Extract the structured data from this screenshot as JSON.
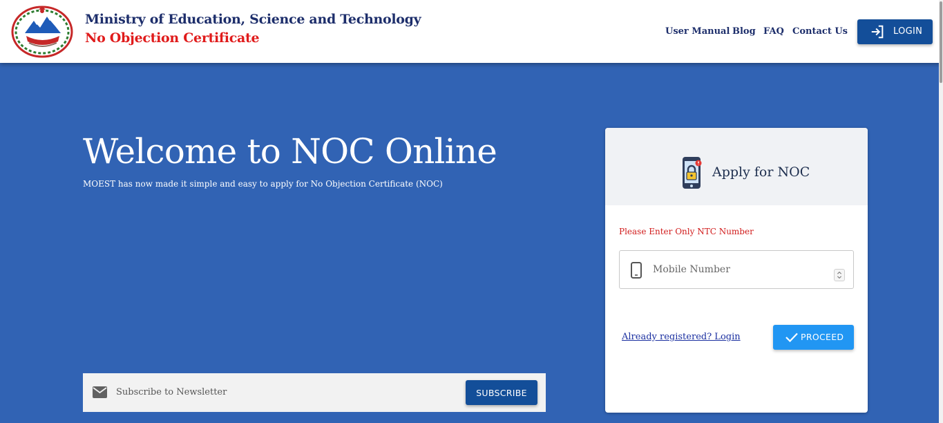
{
  "header": {
    "title": "Ministry of Education, Science and Technology",
    "subtitle": "No Objection Certificate",
    "nav": [
      {
        "label": "User Manual"
      },
      {
        "label": "Blog"
      },
      {
        "label": "FAQ"
      },
      {
        "label": "Contact Us"
      }
    ],
    "login_label": "LOGIN",
    "colors": {
      "title": "#1d2e6b",
      "subtitle": "#e01b1b",
      "button": "#134e99"
    }
  },
  "hero": {
    "title": "Welcome to NOC Online",
    "description": "MOEST has now made it simple and easy to apply for No Objection Certificate (NOC)",
    "background": "#3163b4"
  },
  "newsletter": {
    "placeholder": "Subscribe to Newsletter",
    "button_label": "SUBSCRIBE",
    "icon": "mail-icon"
  },
  "card": {
    "title": "Apply for NOC",
    "icon": "phone-lock-icon",
    "hint": "Please Enter Only NTC Number",
    "mobile_placeholder": "Mobile Number",
    "mobile_value": "",
    "login_link": "Already registered? Login",
    "proceed_label": "PROCEED",
    "proceed_color": "#2196f3"
  }
}
